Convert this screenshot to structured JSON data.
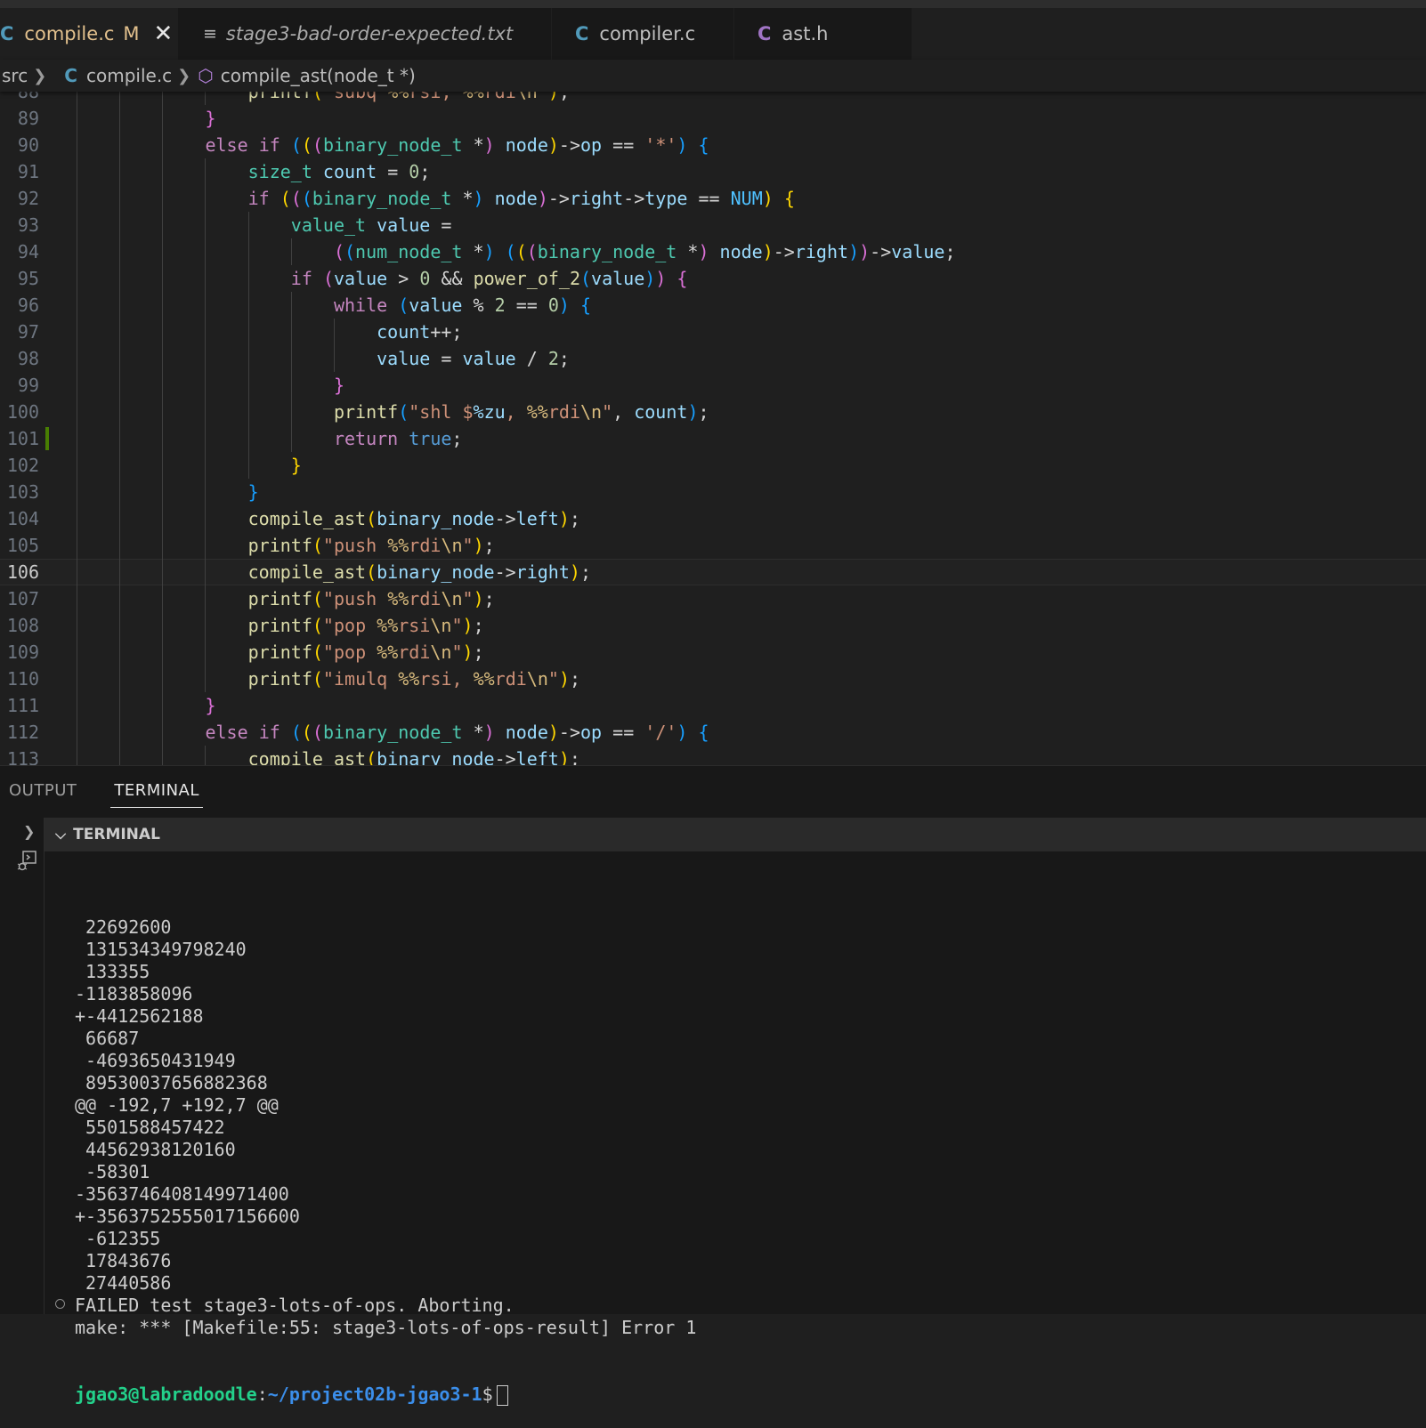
{
  "tabs": [
    {
      "icon": "C",
      "label": "compile.c",
      "modified": "M",
      "active": true
    },
    {
      "icon": "lines",
      "label": "stage3-bad-order-expected.txt",
      "active": false
    },
    {
      "icon": "C",
      "label": "compiler.c",
      "active": false
    },
    {
      "icon": "C",
      "label": "ast.h",
      "active": false
    }
  ],
  "tab_close_glyph": "✕",
  "breadcrumb": {
    "folder": "src",
    "file_icon": "C",
    "file": "compile.c",
    "symbol": "compile_ast(node_t *)"
  },
  "editor": {
    "current_line": "106",
    "lines": [
      {
        "n": "88",
        "text": "printf(\"subq %%rsi, %%rdi\\n\");"
      },
      {
        "n": "89",
        "text": "}"
      },
      {
        "n": "90",
        "text": "else if (((binary_node_t *) node)->op == '*') {"
      },
      {
        "n": "91",
        "text": "size_t count = 0;"
      },
      {
        "n": "92",
        "text": "if (((binary_node_t *) node)->right->type == NUM) {"
      },
      {
        "n": "93",
        "text": "value_t value ="
      },
      {
        "n": "94",
        "text": "((num_node_t *) (((binary_node_t *) node)->right))->value;"
      },
      {
        "n": "95",
        "text": "if (value > 0 && power_of_2(value)) {"
      },
      {
        "n": "96",
        "text": "while (value % 2 == 0) {"
      },
      {
        "n": "97",
        "text": "count++;"
      },
      {
        "n": "98",
        "text": "value = value / 2;"
      },
      {
        "n": "99",
        "text": "}"
      },
      {
        "n": "100",
        "text": "printf(\"shl $%zu, %%rdi\\n\", count);"
      },
      {
        "n": "101",
        "text": "return true;"
      },
      {
        "n": "102",
        "text": "}"
      },
      {
        "n": "103",
        "text": "}"
      },
      {
        "n": "104",
        "text": "compile_ast(binary_node->left);"
      },
      {
        "n": "105",
        "text": "printf(\"push %%rdi\\n\");"
      },
      {
        "n": "106",
        "text": "compile_ast(binary_node->right);"
      },
      {
        "n": "107",
        "text": "printf(\"push %%rdi\\n\");"
      },
      {
        "n": "108",
        "text": "printf(\"pop %%rsi\\n\");"
      },
      {
        "n": "109",
        "text": "printf(\"pop %%rdi\\n\");"
      },
      {
        "n": "110",
        "text": "printf(\"imulq %%rsi, %%rdi\\n\");"
      },
      {
        "n": "111",
        "text": "}"
      },
      {
        "n": "112",
        "text": "else if (((binary_node_t *) node)->op == '/') {"
      },
      {
        "n": "113",
        "text": "compile_ast(binary_node->left);"
      }
    ]
  },
  "panel": {
    "tabs": [
      "OUTPUT",
      "TERMINAL"
    ],
    "active_tab": "TERMINAL",
    "terminal_header": "TERMINAL",
    "terminal_lines": [
      " 22692600",
      " 131534349798240",
      " 133355",
      "-1183858096",
      "+-4412562188",
      " 66687",
      " -4693650431949",
      " 89530037656882368",
      "@@ -192,7 +192,7 @@",
      " 5501588457422",
      " 44562938120160",
      " -58301",
      "-3563746408149971400",
      "+-3563752555017156600",
      " -612355",
      " 17843676",
      " 27440586",
      "FAILED test stage3-lots-of-ops. Aborting.",
      "make: *** [Makefile:55: stage3-lots-of-ops-result] Error 1"
    ],
    "prompt_user": "jgao3@labradoodle",
    "prompt_sep": ":",
    "prompt_path": "~/project02b-jgao3-1",
    "prompt_symbol": "$"
  },
  "icons": {
    "close": "close-icon",
    "file_text": "file-text-icon",
    "chevron_right": "chevron-right-icon",
    "chevron_down": "chevron-down-icon",
    "symbol_method": "symbol-method-icon",
    "terminal_debug": "terminal-debug-icon"
  }
}
